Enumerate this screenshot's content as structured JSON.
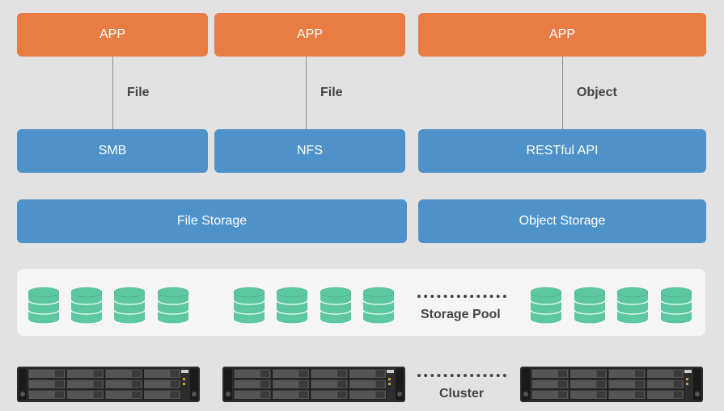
{
  "apps": [
    {
      "label": "APP"
    },
    {
      "label": "APP"
    },
    {
      "label": "APP"
    }
  ],
  "edges": [
    {
      "label": "File"
    },
    {
      "label": "File"
    },
    {
      "label": "Object"
    }
  ],
  "protocols": [
    {
      "label": "SMB"
    },
    {
      "label": "NFS"
    },
    {
      "label": "RESTful API"
    }
  ],
  "storage": [
    {
      "label": "File Storage"
    },
    {
      "label": "Object Storage"
    }
  ],
  "pool": {
    "label": "Storage Pool"
  },
  "cluster": {
    "label": "Cluster"
  },
  "colors": {
    "app": "#e87c43",
    "service": "#4f92c9",
    "disk": "#5dc8a0",
    "background": "#e2e2e2",
    "pool_panel": "#f5f5f5"
  },
  "icons": {
    "disk": "database-disk-icon",
    "server": "rack-server-icon"
  }
}
